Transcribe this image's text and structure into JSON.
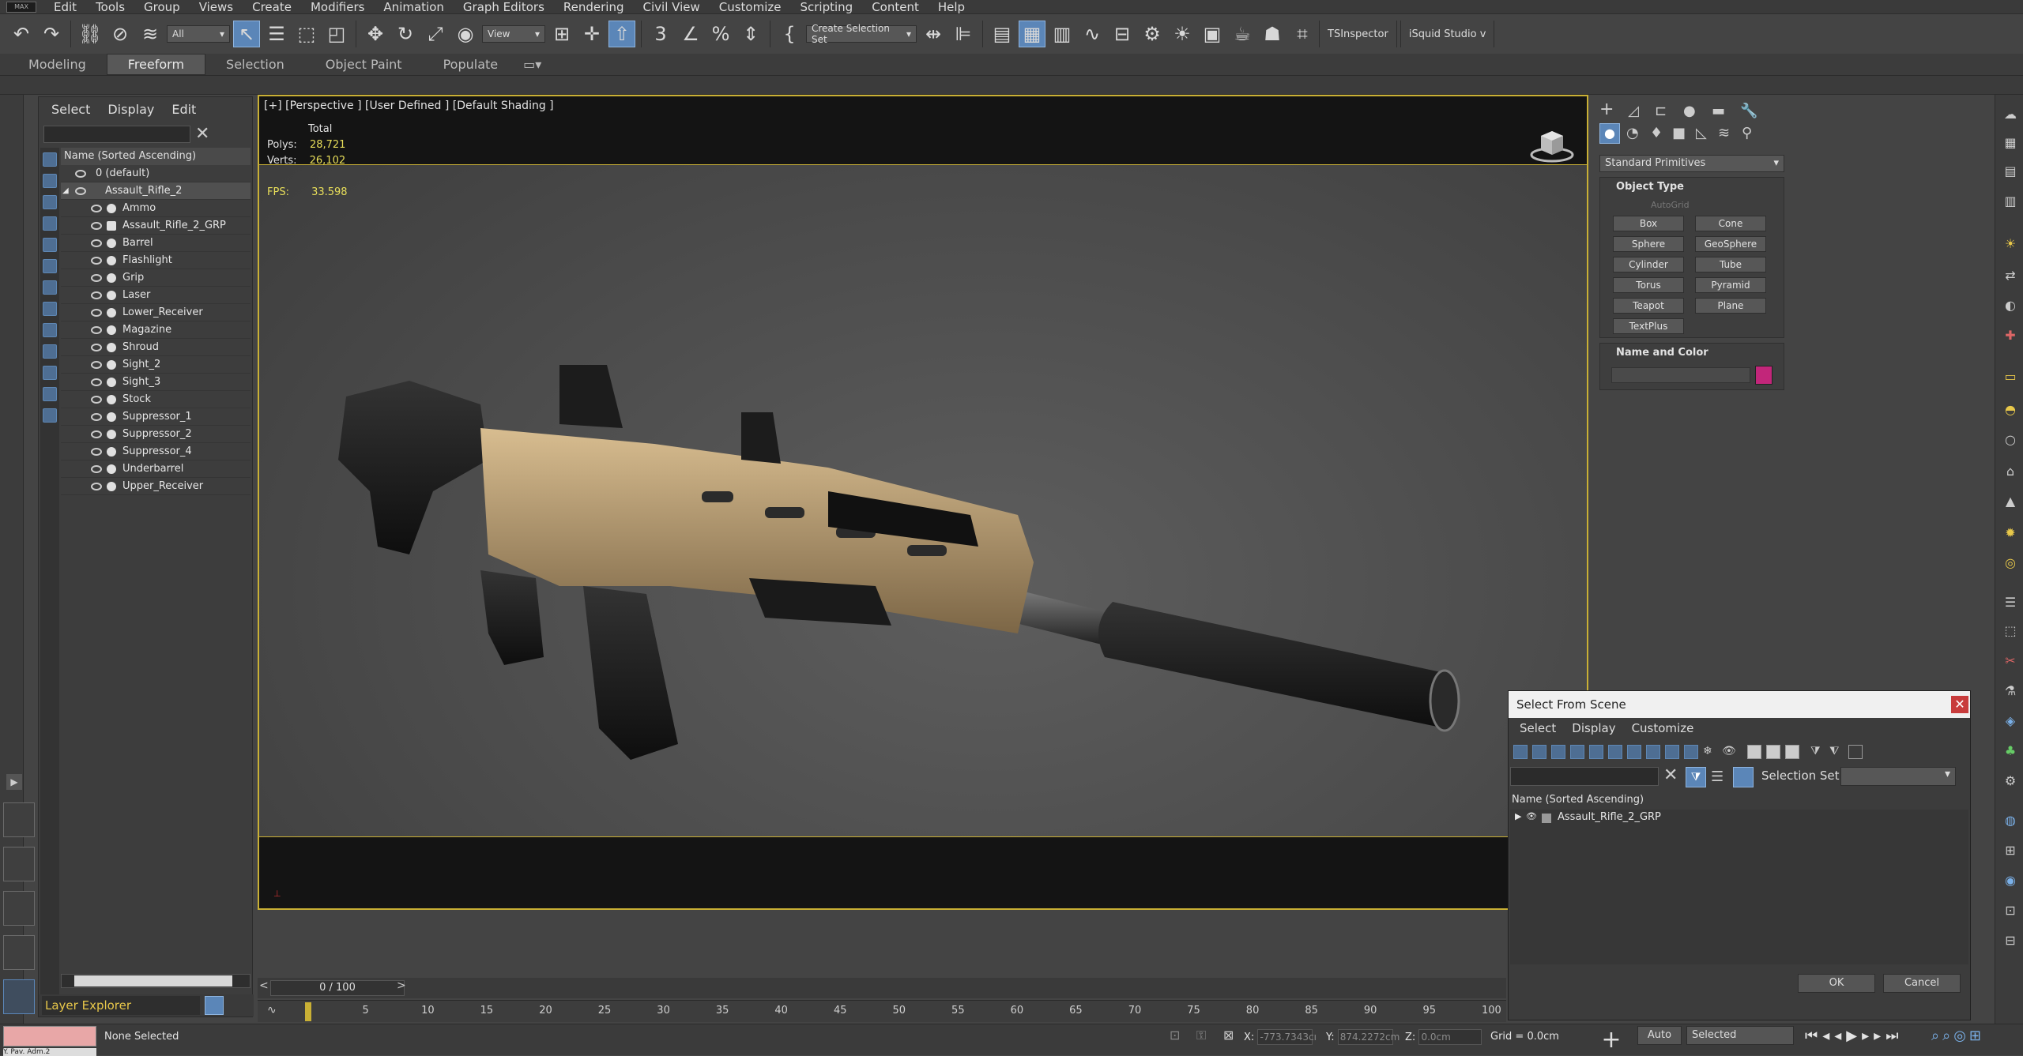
{
  "menubar": {
    "logo": "MAX",
    "items": [
      "Edit",
      "Tools",
      "Group",
      "Views",
      "Create",
      "Modifiers",
      "Animation",
      "Graph Editors",
      "Rendering",
      "Civil View",
      "Customize",
      "Scripting",
      "Content",
      "Help"
    ]
  },
  "toolbar": {
    "filter": "All",
    "view": "View",
    "selection_set": "Create Selection Set",
    "tsinspector": "TSInspector",
    "isquid": "iSquid Studio v"
  },
  "ribbon": {
    "tabs": [
      "Modeling",
      "Freeform",
      "Selection",
      "Object Paint",
      "Populate"
    ]
  },
  "explorer": {
    "menu": [
      "Select",
      "Display",
      "Edit"
    ],
    "header": "Name (Sorted Ascending)",
    "rows": [
      {
        "label": "0 (default)"
      },
      {
        "label": "Assault_Rifle_2"
      },
      {
        "label": "Ammo"
      },
      {
        "label": "Assault_Rifle_2_GRP"
      },
      {
        "label": "Barrel"
      },
      {
        "label": "Flashlight"
      },
      {
        "label": "Grip"
      },
      {
        "label": "Laser"
      },
      {
        "label": "Lower_Receiver"
      },
      {
        "label": "Magazine"
      },
      {
        "label": "Shroud"
      },
      {
        "label": "Sight_2"
      },
      {
        "label": "Sight_3"
      },
      {
        "label": "Stock"
      },
      {
        "label": "Suppressor_1"
      },
      {
        "label": "Suppressor_2"
      },
      {
        "label": "Suppressor_4"
      },
      {
        "label": "Underbarrel"
      },
      {
        "label": "Upper_Receiver"
      }
    ],
    "layer_explorer": "Layer Explorer"
  },
  "viewport": {
    "label": "[+] [Perspective ] [User Defined ] [Default Shading ]",
    "total": "Total",
    "polys_label": "Polys:",
    "polys": "28,721",
    "verts_label": "Verts:",
    "verts": "26,102",
    "fps_label": "FPS:",
    "fps": "33.598"
  },
  "timeline": {
    "frame": "0 / 100",
    "ticks": [
      "5",
      "10",
      "15",
      "20",
      "25",
      "30",
      "35",
      "40",
      "45",
      "50",
      "55",
      "60",
      "65",
      "70",
      "75",
      "80",
      "85",
      "90",
      "95",
      "100"
    ],
    "current": 0,
    "total": 100
  },
  "status": {
    "selection": "None Selected",
    "x_label": "X:",
    "x": "-773.7343cı",
    "y_label": "Y:",
    "y": "874.2272cm",
    "z_label": "Z:",
    "z": "0.0cm",
    "grid": "Grid = 0.0cm",
    "auto": "Auto",
    "selected": "Selected",
    "layer_text": "Y. Pav. Adm.2"
  },
  "cmdpanel": {
    "dropdown": "Standard Primitives",
    "object_type": "Object Type",
    "autogrid": "AutoGrid",
    "buttons": [
      "Box",
      "Cone",
      "Sphere",
      "GeoSphere",
      "Cylinder",
      "Tube",
      "Torus",
      "Pyramid",
      "Teapot",
      "Plane",
      "TextPlus"
    ],
    "name_and_color": "Name and Color",
    "color": "#c2267a"
  },
  "dialog": {
    "title": "Select From Scene",
    "menu": [
      "Select",
      "Display",
      "Customize"
    ],
    "selection_set_label": "Selection Set:",
    "header": "Name (Sorted Ascending)",
    "row": "Assault_Rifle_2_GRP",
    "ok": "OK",
    "cancel": "Cancel"
  },
  "colors": {
    "accent": "#5b86b8",
    "viewport_border": "#c9b035",
    "stats": "#e9df5a"
  }
}
